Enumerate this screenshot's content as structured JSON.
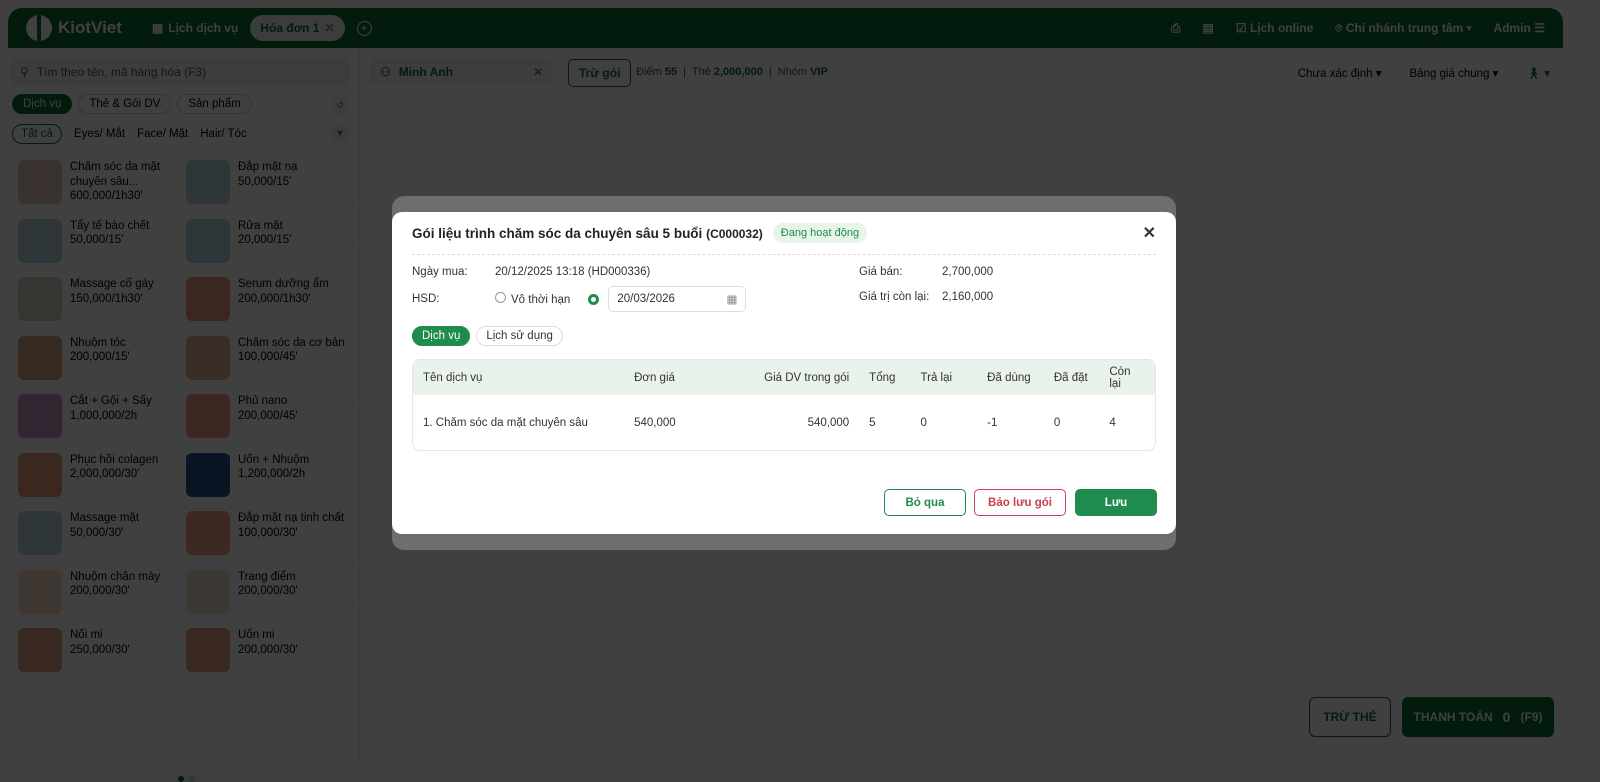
{
  "header": {
    "logo": "KiotViet",
    "tabs": [
      {
        "label": "Lịch dịch vụ"
      },
      {
        "label": "Hóa đơn 1"
      }
    ],
    "online": "Lịch online",
    "branch": "Chi nhánh trung tâm",
    "user": "Admin"
  },
  "search": {
    "placeholder": "Tìm theo tên, mã hàng hóa (F3)"
  },
  "type_tabs": [
    "Dịch vụ",
    "Thẻ & Gói DV",
    "Sản phẩm"
  ],
  "categories": [
    "Tất cả",
    "Eyes/ Mắt",
    "Face/ Mặt",
    "Hair/ Tóc"
  ],
  "products": [
    {
      "name": "Chăm sóc da mặt chuyên sâu...",
      "price": "600,000/1h30'",
      "color": "#e9c8c0"
    },
    {
      "name": "Đắp mặt nạ",
      "price": "50,000/15'",
      "color": "#b9d8e6"
    },
    {
      "name": "Tẩy tế bào chết",
      "price": "50,000/15'",
      "color": "#b9d8e6"
    },
    {
      "name": "Rửa mặt",
      "price": "20,000/15'",
      "color": "#b9d8e6"
    },
    {
      "name": "Massage cổ gáy",
      "price": "150,000/1h30'",
      "color": "#ddd3c8"
    },
    {
      "name": "Serum dưỡng ẩm",
      "price": "200,000/1h30'",
      "color": "#e6a27a"
    },
    {
      "name": "Nhuộm tóc",
      "price": "200,000/15'",
      "color": "#d9a37a"
    },
    {
      "name": "Chăm sóc da cơ bản",
      "price": "100,000/45'",
      "color": "#e8b59b"
    },
    {
      "name": "Cắt + Gội + Sấy",
      "price": "1,000,000/2h",
      "color": "#c49ac8"
    },
    {
      "name": "Phủ nano",
      "price": "200,000/45'",
      "color": "#e6a27a"
    },
    {
      "name": "Phục hồi colagen",
      "price": "2,000,000/30'",
      "color": "#e6a27a"
    },
    {
      "name": "Uốn + Nhuộm",
      "price": "1,200,000/2h",
      "color": "#2b4f86"
    },
    {
      "name": "Massage mặt",
      "price": "50,000/30'",
      "color": "#b9d8e6"
    },
    {
      "name": "Đắp mặt nạ tinh chất",
      "price": "100,000/30'",
      "color": "#f0a37f"
    },
    {
      "name": "Nhuộm chân mày",
      "price": "200,000/30'",
      "color": "#f2d6c4"
    },
    {
      "name": "Trang điểm",
      "price": "200,000/30'",
      "color": "#eee2d5"
    },
    {
      "name": "Nối mi",
      "price": "250,000/30'",
      "color": "#e8a08c"
    },
    {
      "name": "Uốn mi",
      "price": "200,000/30'",
      "color": "#e8a08c"
    }
  ],
  "customer": {
    "name": "Minh Anh",
    "deduct_label": "Trừ gói",
    "points_label": "Điểm",
    "points": "55",
    "card_label": "Thẻ",
    "card": "2,000,000",
    "group_label": "Nhóm",
    "group": "VIP"
  },
  "selects": {
    "status": "Chưa xác định",
    "pricebook": "Bảng giá chung"
  },
  "bottom": {
    "deduct_card": "TRỪ THẺ",
    "pay": "THANH TOÁN",
    "total": "0",
    "shortcut": "(F9)"
  },
  "modal": {
    "title": "Gói liệu trình chăm sóc da chuyên sâu 5 buổi",
    "code": "(C000032)",
    "status": "Đang hoạt động",
    "purchase_label": "Ngày mua:",
    "purchase": "20/12/2025 13:18 (HD000336)",
    "expiry_label": "HSD:",
    "unlimited": "Vô thời hạn",
    "expiry_date": "20/03/2026",
    "price_label": "Giá bán:",
    "price": "2,700,000",
    "remain_label": "Giá trị còn lại:",
    "remain": "2,160,000",
    "tabs": [
      "Dịch vụ",
      "Lịch sử dụng"
    ],
    "columns": [
      "Tên dịch vụ",
      "Đơn giá",
      "Giá DV trong gói",
      "Tổng",
      "Trả lại",
      "Đã dùng",
      "Đã đặt",
      "Còn lại"
    ],
    "rows": [
      [
        "1. Chăm sóc da mặt chuyên sâu",
        "540,000",
        "540,000",
        "5",
        "0",
        "-1",
        "0",
        "4"
      ]
    ],
    "buttons": {
      "skip": "Bỏ qua",
      "reserve": "Bảo lưu gói",
      "save": "Lưu"
    }
  }
}
